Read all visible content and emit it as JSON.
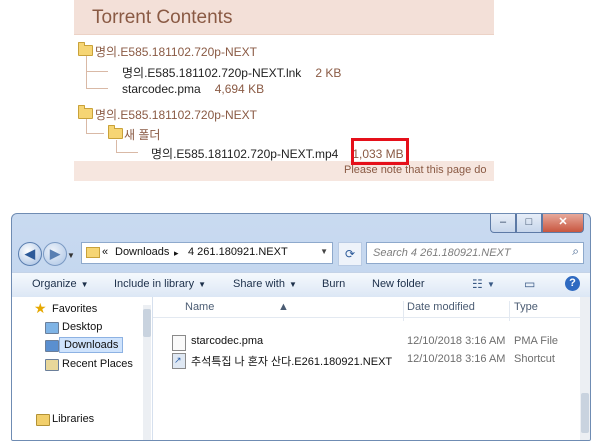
{
  "torrent": {
    "title": "Torrent Contents",
    "folder1": "명의.E585.181102.720p-NEXT",
    "folder1_files": [
      {
        "name": "명의.E585.181102.720p-NEXT.lnk",
        "size": "2 KB"
      },
      {
        "name": "starcodec.pma",
        "size": "4,694 KB"
      }
    ],
    "folder2": "명의.E585.181102.720p-NEXT",
    "subfolder": "새 폴더",
    "subfolder_files": [
      {
        "name": "명의.E585.181102.720p-NEXT.mp4",
        "size": "1,033 MB"
      }
    ],
    "note": "Please note that this page do"
  },
  "explorer": {
    "window_controls": {
      "minimize": "–",
      "maximize": "□",
      "close": "✕"
    },
    "nav": {
      "back": "◀",
      "forward": "▶"
    },
    "address": {
      "prefix": "«",
      "crumb1": "Downloads",
      "separator": "▸",
      "crumb2": "4 261.180921.NEXT"
    },
    "search_placeholder": "Search 4 261.180921.NEXT",
    "toolbar": {
      "organize": "Organize",
      "include": "Include in library",
      "share": "Share with",
      "burn": "Burn",
      "new_folder": "New folder"
    },
    "sidebar": {
      "favorites": "Favorites",
      "items": [
        "Desktop",
        "Downloads",
        "Recent Places"
      ],
      "libraries": "Libraries"
    },
    "columns": {
      "name": "Name",
      "date": "Date modified",
      "type": "Type"
    },
    "files": [
      {
        "name": "starcodec.pma",
        "date": "12/10/2018 3:16 AM",
        "type": "PMA File"
      },
      {
        "name": "추석특집 나 혼자 산다.E261.180921.NEXT",
        "date": "12/10/2018 3:16 AM",
        "type": "Shortcut"
      }
    ],
    "highlight_color": "#e5101a"
  }
}
